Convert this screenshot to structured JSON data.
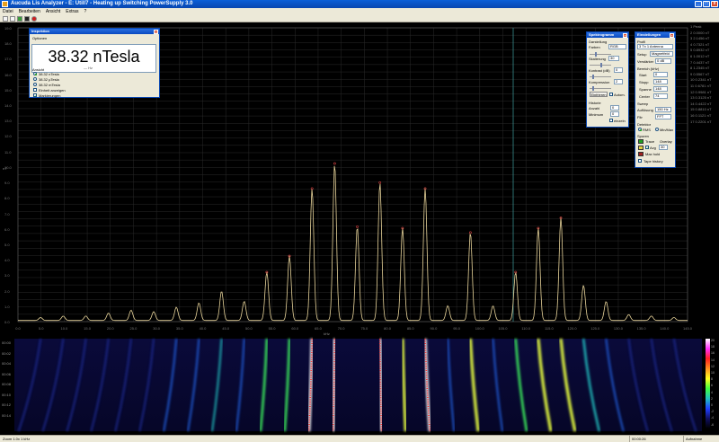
{
  "window": {
    "title": "Aucuda Lis Analyzer - E: Utill7 - Heating up Switching PowerSupply 3.0",
    "buttons": [
      "_",
      "□",
      "x"
    ]
  },
  "menu": [
    "Datei",
    "Bearbeiten",
    "Ansicht",
    "Extras",
    "?"
  ],
  "toolbar": [
    "open-icon",
    "save-icon",
    "play-icon",
    "stop-icon",
    "record-icon"
  ],
  "plot": {
    "y_ticks": [
      "19.0",
      "18.0",
      "17.0",
      "16.0",
      "15.0",
      "14.0",
      "13.0",
      "12.0",
      "11.0",
      "10.0",
      "9.0",
      "8.0",
      "7.0",
      "6.0",
      "5.0",
      "4.0",
      "3.0",
      "2.0",
      "1.0",
      "0.0"
    ],
    "y_unit": "nT",
    "x_ticks": [
      "0.0",
      "5.0",
      "10.0",
      "15.0",
      "20.0",
      "25.0",
      "30.0",
      "35.0",
      "40.0",
      "45.0",
      "50.0",
      "55.0",
      "60.0",
      "65.0",
      "70.0",
      "75.0",
      "80.0",
      "85.0",
      "90.0",
      "95.0",
      "100.0",
      "105.0",
      "110.0",
      "115.0",
      "120.0",
      "125.0",
      "130.0",
      "135.0",
      "140.0",
      "145.0"
    ],
    "x_unit": "kHz",
    "grid_color": "#2a2a2a",
    "trace_color": "#e8d49a",
    "marker_color": "#d04040",
    "cursor_color": "#40a0a0"
  },
  "chart_data": {
    "type": "line",
    "title": "",
    "xlabel": "kHz",
    "ylabel": "nT",
    "xlim": [
      0,
      148
    ],
    "ylim": [
      0,
      20
    ],
    "series": [
      {
        "peaks_x": [
          5,
          10,
          15,
          20,
          25,
          30,
          35,
          40,
          45,
          50,
          55,
          60,
          65,
          70,
          75,
          80,
          85,
          90,
          95,
          100,
          105,
          110,
          115,
          120,
          125,
          130,
          135,
          140,
          145
        ],
        "peaks_y": [
          0.2,
          0.3,
          0.3,
          0.5,
          0.7,
          0.6,
          0.9,
          1.2,
          2.0,
          1.3,
          3.3,
          4.4,
          9.0,
          10.7,
          6.4,
          9.4,
          6.3,
          9.0,
          1.0,
          6.0,
          1.0,
          3.3,
          6.3,
          7.0,
          2.4,
          1.3,
          0.4,
          0.3,
          0.2
        ]
      }
    ]
  },
  "right_list": [
    "1 Peak",
    "2 0.0000 nT",
    "3 2.1456 nT",
    "4 0.7321 nT",
    "5 0.8932 nT",
    "6 1.0012 nT",
    "7 0.4437 nT",
    "8 1.2345 nT",
    "9 0.5567 nT",
    "10 0.2341 nT",
    "11 0.6781 nT",
    "12 0.9981 nT",
    "13 0.3125 nT",
    "14 0.4422 nT",
    "15 0.8810 nT",
    "16 0.1121 nT",
    "17 0.2201 nT"
  ],
  "spectrogram": {
    "y_ticks": [
      "00:00",
      "00:02",
      "00:04",
      "00:06",
      "00:08",
      "00:10",
      "00:12",
      "00:14"
    ],
    "colorbar_ticks": [
      "20",
      "18",
      "16",
      "14",
      "12",
      "10",
      "8",
      "6",
      "4",
      "2",
      "0",
      "-2",
      "-4",
      "-6"
    ]
  },
  "status": {
    "left": "Zoom 1.0x 1 kHz",
    "mid": "00:00:26",
    "right": "Aufnahme"
  },
  "inspektion": {
    "title": "Inspektion",
    "section": "Optionen",
    "value": "38.32 nTesla",
    "sub": "—  Hz",
    "ansicht_label": "Ansicht",
    "options": [
      "38.32 nTesla",
      "38.32 µTesla",
      "38.32 mTesla",
      "Einheit anzeigen",
      "Markierungen"
    ],
    "selected_index": 0
  },
  "spectrogramm_panel": {
    "title": "Spektrogramm",
    "darstellung": "Darstellung",
    "farben_label": "Farben",
    "farben_value": "RGB",
    "skalierung_label": "Skalierung",
    "skalierung_value": "30",
    "kontrast_label": "Kontrast (dB)",
    "kontrast_value": "0",
    "kompression_label": "Kompression",
    "kompression_value": "2",
    "buttons": [
      "Einfrieren",
      "Autom."
    ],
    "historie_label": "Historie",
    "anzahl_label": "Anzahl",
    "anzahl_value": "0",
    "minimum_label": "Minimum",
    "minimum_value": "0",
    "einzeln_label": "einzeln"
  },
  "einstellungen": {
    "title": "Einstellungen",
    "profil_label": "Profil",
    "profil_value": "3 Tx 1 Antenna",
    "setup_label": "Setup",
    "setup_value": "Magnetfeld",
    "verstaerker_label": "Verstärker",
    "verstaerker_value": "0 dB",
    "bereich_label": "Bereich (kHz)",
    "start_label": "Start",
    "start_value": "0",
    "stopp_label": "Stopp",
    "stopp_value": "148",
    "spanne_label": "Spanne",
    "spanne_value": "148",
    "center_label": "Center",
    "center_value": "74",
    "sweep_label": "Sweep",
    "aufloesung_label": "Auflösung",
    "aufloesung_value": "150 Hz",
    "fft_label": "Fltr",
    "fft_value": "FFT",
    "detektor_label": "Detektor",
    "detektor_options": [
      "RMS",
      "Min/Max"
    ],
    "spuren_label": "Spuren",
    "spuren": [
      {
        "name": "Trace",
        "extra": "Overlay",
        "color": "#21a121"
      },
      {
        "name": "Avg",
        "extra": "30",
        "color": "#e0d040"
      },
      {
        "name": "Max hold",
        "extra": "",
        "color": "#a02020"
      }
    ],
    "tape_label": "Tape history"
  }
}
